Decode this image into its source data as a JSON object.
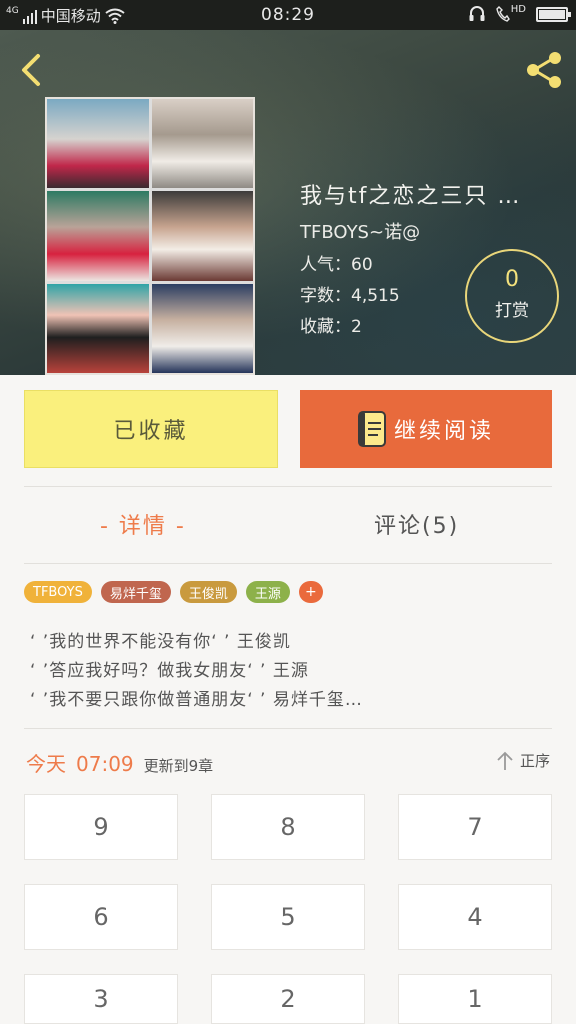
{
  "status_bar": {
    "network": "4G",
    "carrier": "中国移动",
    "time": "08:29",
    "hd_label": "HD"
  },
  "book": {
    "title": "我与tf之恋之三只 …",
    "author": "TFBOYS~诺@",
    "popularity": "人气：60",
    "word_count": "字数：4,515",
    "favorites": "收藏：2"
  },
  "reward": {
    "count": "0",
    "label": "打赏"
  },
  "actions": {
    "favorite_label": "已收藏",
    "read_label": "继续阅读"
  },
  "tabs": {
    "detail": "-  详情  -",
    "comments": "评论(5)"
  },
  "tags": [
    {
      "label": "TFBOYS",
      "color": "#f0b23a"
    },
    {
      "label": "易烊千玺",
      "color": "#c0664e"
    },
    {
      "label": "王俊凯",
      "color": "#c99a3e"
    },
    {
      "label": "王源",
      "color": "#8db14a"
    }
  ],
  "tag_more": "+",
  "description": [
    "‘ ’我的世界不能没有你‘ ’ 王俊凯",
    "‘ ’答应我好吗？做我女朋友‘ ’ 王源",
    "‘ ’我不要只跟你做普通朋友‘ ’ 易烊千玺…"
  ],
  "update": {
    "day": "今天",
    "time": "07:09",
    "text": "更新到9章"
  },
  "sort_label": "正序",
  "chapters": [
    "9",
    "8",
    "7",
    "6",
    "5",
    "4",
    "3",
    "2",
    "1"
  ],
  "colors": {
    "accent": "#ee7b4a",
    "favorite_bg": "#faf07d",
    "read_bg": "#e86a3c",
    "reward_ring": "#e9d67a"
  }
}
